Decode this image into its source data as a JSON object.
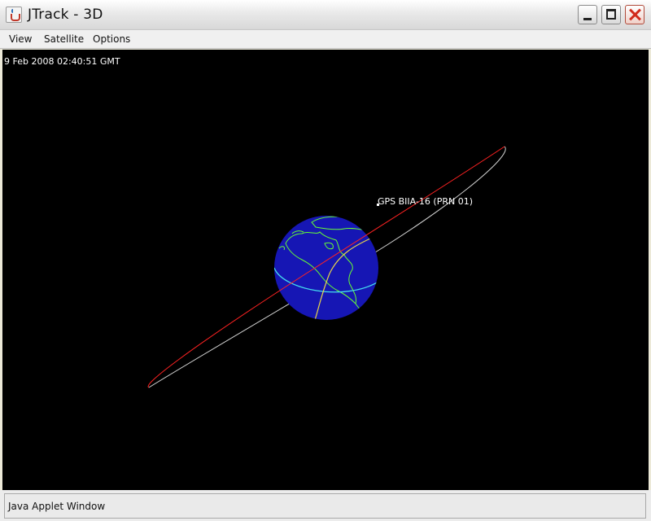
{
  "window": {
    "title": "JTrack - 3D",
    "icon": "java-cup-icon"
  },
  "menu": [
    {
      "label": "View"
    },
    {
      "label": "Satellite"
    },
    {
      "label": "Options"
    }
  ],
  "view": {
    "timestamp": "9 Feb 2008 02:40:51 GMT",
    "satellite": {
      "name": "GPS BIIA-16 (PRN 01)"
    },
    "colors": {
      "background": "#000000",
      "earth": "#1616b4",
      "coastlines": "#66ff33",
      "orbit_front": "#ff2222",
      "orbit_back": "#cfcfcf",
      "equator": "#44ddee",
      "terminator": "#e8d54a"
    }
  },
  "status": {
    "text": "Java Applet Window"
  }
}
